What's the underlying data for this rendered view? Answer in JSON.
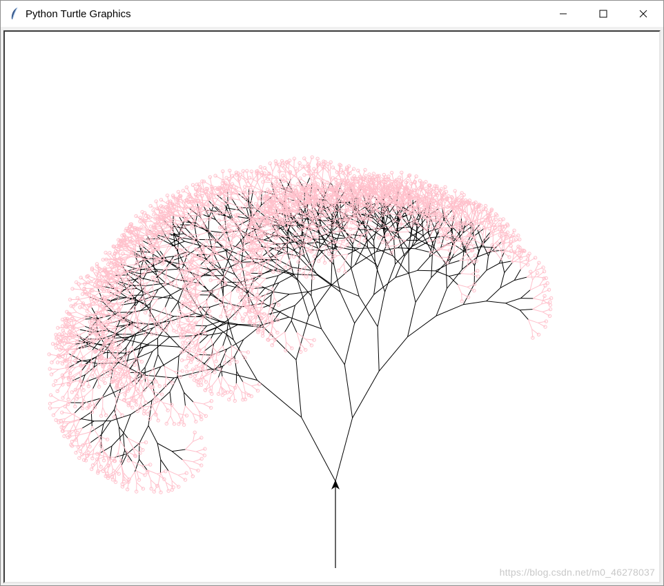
{
  "window": {
    "title": "Python Turtle Graphics",
    "icon": "feather-icon",
    "controls": [
      "minimize-icon",
      "maximize-icon",
      "close-icon"
    ]
  },
  "canvas": {
    "background": "#ffffff",
    "branch_color": "#000000",
    "leaf_color": "#ffc0cb",
    "turtle_icon": "arrow-turtle-icon"
  },
  "watermark": "https://blog.csdn.net/m0_46278037"
}
